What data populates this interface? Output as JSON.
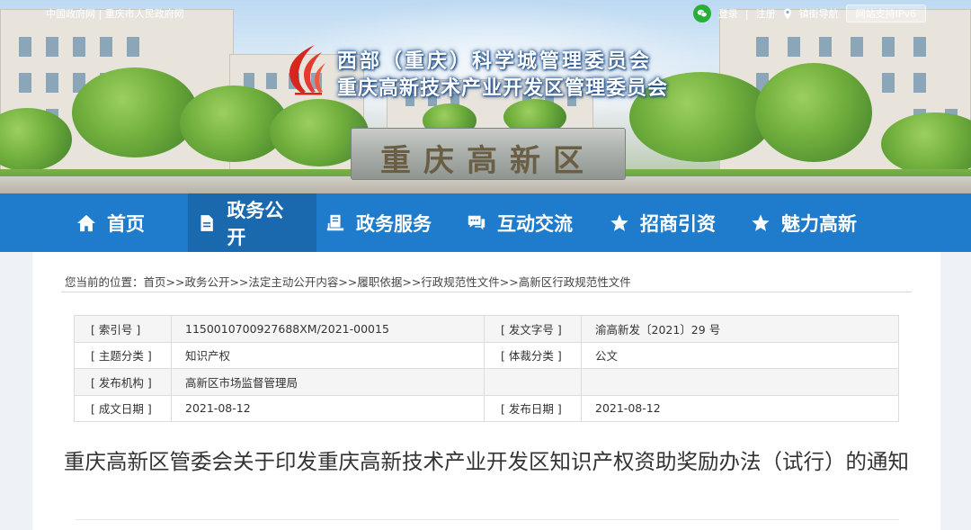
{
  "top_bar": {
    "left_links": [
      "中国政府网",
      "重庆市人民政府网"
    ],
    "separator": "|",
    "login": "登录",
    "register": "注册",
    "street_nav": "镇街导航",
    "ipv6": "网站支持IPv6"
  },
  "header": {
    "title_line1": "西部（重庆）科学城管理委员会",
    "title_line2": "重庆高新技术产业开发区管理委员会",
    "stone_text": "重庆高新区"
  },
  "nav": {
    "items": [
      {
        "label": "首页",
        "icon": "home-icon"
      },
      {
        "label": "政务公开",
        "icon": "document-icon",
        "active": true
      },
      {
        "label": "政务服务",
        "icon": "service-icon"
      },
      {
        "label": "互动交流",
        "icon": "chat-icon"
      },
      {
        "label": "招商引资",
        "icon": "star-icon"
      },
      {
        "label": "魅力高新",
        "icon": "star-icon"
      }
    ]
  },
  "breadcrumb": "您当前的位置：首页>>政务公开>>法定主动公开内容>>履职依据>>行政规范性文件>>高新区行政规范性文件",
  "meta": {
    "rows": [
      {
        "label1": "[ 索引号 ]",
        "value1": "1150010700927688XM/2021-00015",
        "label2": "[ 发文字号 ]",
        "value2": "渝高新发〔2021〕29 号"
      },
      {
        "label1": "[ 主题分类 ]",
        "value1": "知识产权",
        "label2": "[ 体裁分类 ]",
        "value2": "公文"
      },
      {
        "label1": "[ 发布机构 ]",
        "value1": "高新区市场监督管理局",
        "label2": "",
        "value2": ""
      },
      {
        "label1": "[ 成文日期 ]",
        "value1": "2021-08-12",
        "label2": "[ 发布日期 ]",
        "value2": "2021-08-12"
      }
    ]
  },
  "document": {
    "title": "重庆高新区管委会关于印发重庆高新技术产业开发区知识产权资助奖励办法（试行）的通知"
  },
  "colors": {
    "nav_bg": "#1f7ccc",
    "nav_active": "#1a68ad",
    "logo_red": "#d7261e"
  }
}
